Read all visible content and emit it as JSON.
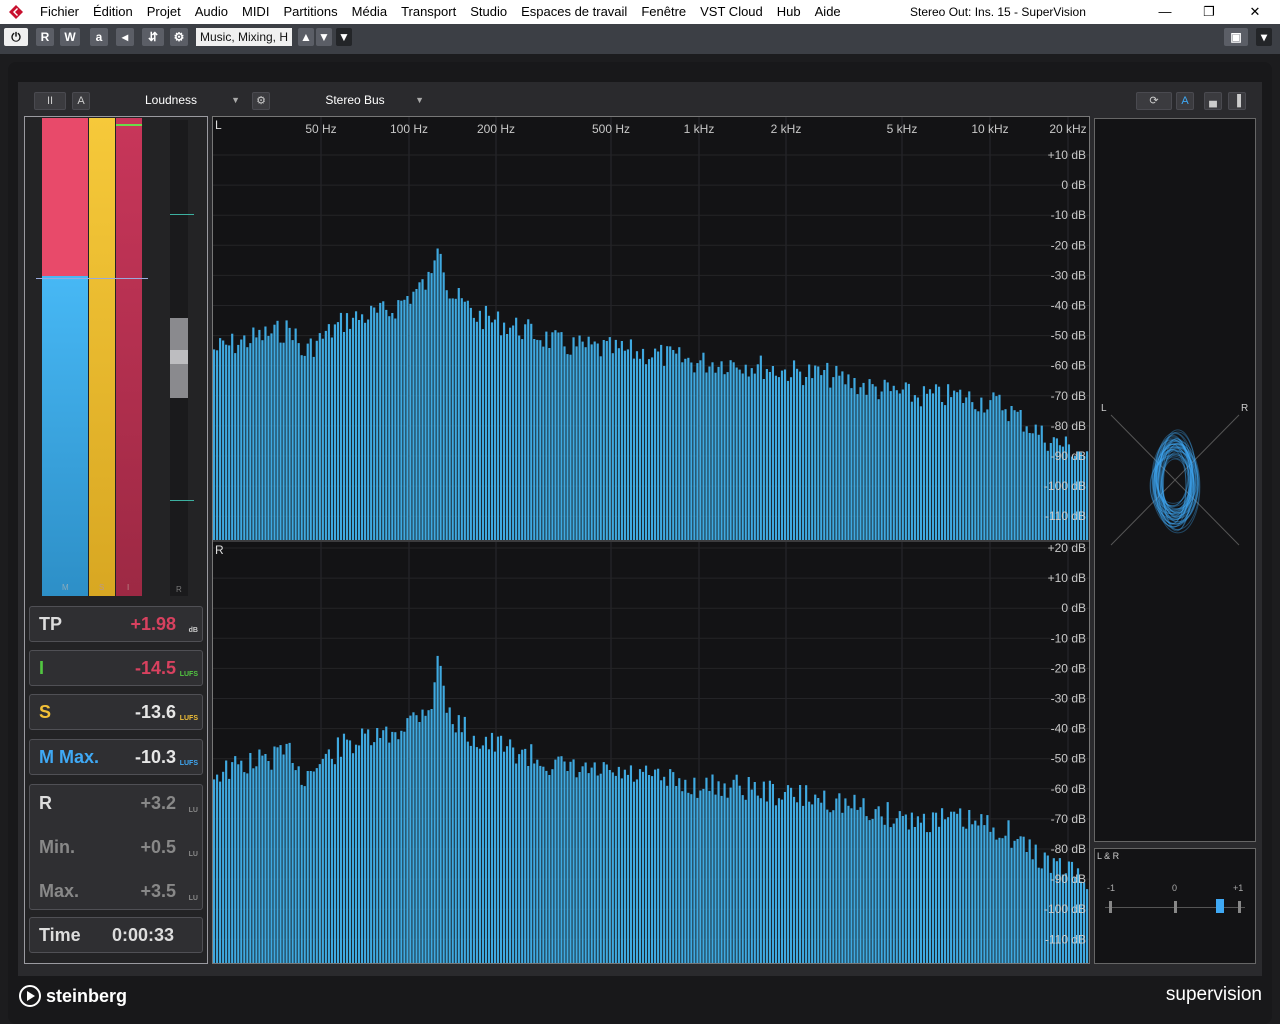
{
  "menubar": {
    "items": [
      "Fichier",
      "Édition",
      "Projet",
      "Audio",
      "MIDI",
      "Partitions",
      "Média",
      "Transport",
      "Studio",
      "Espaces de travail",
      "Fenêtre",
      "VST Cloud",
      "Hub",
      "Aide"
    ],
    "window_title": "Stereo Out: Ins. 15 - SuperVision",
    "minimize": "—",
    "restore": "❐",
    "close": "✕"
  },
  "toolbar": {
    "power": "⏻",
    "read": "R",
    "write": "W",
    "preset": "Music, Mixing, H",
    "compare": "a",
    "dropdown": "▼"
  },
  "header": {
    "pause": "II",
    "a_label": "A",
    "module": "Loudness",
    "source": "Stereo Bus",
    "a_right": "A"
  },
  "meter": {
    "bar_labels": [
      "M",
      "S",
      "I",
      "R"
    ],
    "m_level": 0.67,
    "s_level": 1.0,
    "i_level": 1.0
  },
  "readouts": [
    {
      "label": "TP",
      "value": "+1.98",
      "unit": "dB",
      "label_color": "#dddddd",
      "value_color": "#d8415f",
      "unit_color": "#cccccc"
    },
    {
      "label": "I",
      "value": "-14.5",
      "unit": "LUFS",
      "label_color": "#52c741",
      "value_color": "#d8415f",
      "unit_color": "#52c741"
    },
    {
      "label": "S",
      "value": "-13.6",
      "unit": "LUFS",
      "label_color": "#f2c037",
      "value_color": "#e6e6e6",
      "unit_color": "#f2c037"
    },
    {
      "label": "M Max.",
      "value": "-10.3",
      "unit": "LUFS",
      "label_color": "#3fa9f5",
      "value_color": "#e6e6e6",
      "unit_color": "#3fa9f5"
    }
  ],
  "range_box": [
    {
      "label": "R",
      "value": "+3.2",
      "unit": "LU"
    },
    {
      "label": "Min.",
      "value": "+0.5",
      "unit": "LU"
    },
    {
      "label": "Max.",
      "value": "+3.5",
      "unit": "LU"
    }
  ],
  "time": {
    "label": "Time",
    "value": "0:00:33"
  },
  "spectrum": {
    "freq_labels": [
      "50 Hz",
      "100 Hz",
      "200 Hz",
      "500 Hz",
      "1 kHz",
      "2 kHz",
      "5 kHz",
      "10 kHz",
      "20 kHz"
    ],
    "db_labels_top": [
      "+10 dB",
      "0 dB",
      "-10 dB",
      "-20 dB",
      "-30 dB",
      "-40 dB",
      "-50 dB",
      "-60 dB",
      "-70 dB",
      "-80 dB",
      "-90 dB",
      "-100 dB",
      "-110 dB"
    ],
    "db_labels_bottom": [
      "+20 dB",
      "+10 dB",
      "0 dB",
      "-10 dB",
      "-20 dB",
      "-30 dB",
      "-40 dB",
      "-50 dB",
      "-60 dB",
      "-70 dB",
      "-80 dB",
      "-90 dB",
      "-100 dB",
      "-110 dB"
    ],
    "channel_l": "L",
    "channel_r": "R",
    "bar_color": "#3fa9e0"
  },
  "scope": {
    "left": "L",
    "right": "R"
  },
  "correlation": {
    "title": "L & R",
    "min": "-1",
    "mid": "0",
    "max": "+1",
    "value": 0.7
  },
  "footer": {
    "brand_left": "steinberg",
    "brand_right": "supervision"
  }
}
